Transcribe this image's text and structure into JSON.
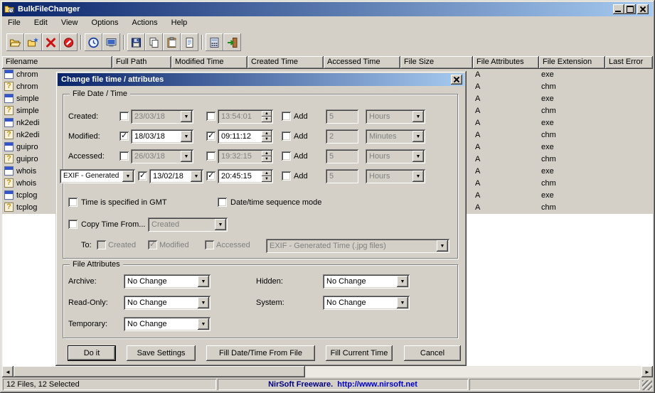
{
  "window": {
    "title": "BulkFileChanger"
  },
  "menu": {
    "items": [
      "File",
      "Edit",
      "View",
      "Options",
      "Actions",
      "Help"
    ]
  },
  "toolbar": {
    "buttons": [
      "open-folder",
      "add-files",
      "remove-files",
      "stop",
      "change-time",
      "view-display",
      "save",
      "copy",
      "paste",
      "properties",
      "advanced-options",
      "exit"
    ]
  },
  "list": {
    "columns": [
      "Filename",
      "Full Path",
      "Modified Time",
      "Created Time",
      "Accessed Time",
      "File Size",
      "File Attributes",
      "File Extension",
      "Last Error"
    ],
    "rows": [
      {
        "filename": "chrom",
        "attributes": "A",
        "extension": "exe",
        "icon": "app-icon"
      },
      {
        "filename": "chrom",
        "attributes": "A",
        "extension": "chm",
        "icon": "help-icon"
      },
      {
        "filename": "simple",
        "attributes": "A",
        "extension": "exe",
        "icon": "app-icon"
      },
      {
        "filename": "simple",
        "attributes": "A",
        "extension": "chm",
        "icon": "help-icon"
      },
      {
        "filename": "nk2edi",
        "attributes": "A",
        "extension": "exe",
        "icon": "app-icon"
      },
      {
        "filename": "nk2edi",
        "attributes": "A",
        "extension": "chm",
        "icon": "help-icon"
      },
      {
        "filename": "guipro",
        "attributes": "A",
        "extension": "exe",
        "icon": "app-icon"
      },
      {
        "filename": "guipro",
        "attributes": "A",
        "extension": "chm",
        "icon": "help-icon"
      },
      {
        "filename": "whois",
        "attributes": "A",
        "extension": "exe",
        "icon": "app-icon"
      },
      {
        "filename": "whois",
        "attributes": "A",
        "extension": "chm",
        "icon": "help-icon"
      },
      {
        "filename": "tcplog",
        "attributes": "A",
        "extension": "exe",
        "icon": "app-icon"
      },
      {
        "filename": "tcplog",
        "attributes": "A",
        "extension": "chm",
        "icon": "help-icon"
      }
    ]
  },
  "dialog": {
    "title": "Change file time / attributes",
    "datetime_group": {
      "label": "File Date / Time",
      "rows": [
        {
          "label": "Created:",
          "date": "23/03/18",
          "date_checked": false,
          "time": "13:54:01",
          "time_checked": false,
          "add_label": "Add",
          "add_checked": false,
          "add_value": "5",
          "add_unit": "Hours",
          "enabled": false
        },
        {
          "label": "Modified:",
          "date": "18/03/18",
          "date_checked": true,
          "time": "09:11:12",
          "time_checked": true,
          "add_label": "Add",
          "add_checked": false,
          "add_value": "2",
          "add_unit": "Minutes",
          "enabled": true
        },
        {
          "label": "Accessed:",
          "date": "26/03/18",
          "date_checked": false,
          "time": "19:32:15",
          "time_checked": false,
          "add_label": "Add",
          "add_checked": false,
          "add_value": "5",
          "add_unit": "Hours",
          "enabled": false
        },
        {
          "label": "EXIF - Generated",
          "date": "13/02/18",
          "date_checked": true,
          "time": "20:45:15",
          "time_checked": true,
          "add_label": "Add",
          "add_checked": false,
          "add_value": "5",
          "add_unit": "Hours",
          "enabled": true,
          "label_is_dropdown": true
        }
      ],
      "gmt_label": "Time is specified in GMT",
      "gmt_checked": false,
      "sequence_label": "Date/time sequence mode",
      "sequence_checked": false,
      "copy_time_label": "Copy Time From...",
      "copy_time_checked": false,
      "copy_time_source": "Created",
      "to_label": "To:",
      "to_created": "Created",
      "to_created_checked": false,
      "to_modified": "Modified",
      "to_modified_checked": true,
      "to_accessed": "Accessed",
      "to_accessed_checked": false,
      "to_destination": "EXIF - Generated Time (.jpg files)"
    },
    "attributes_group": {
      "label": "File Attributes",
      "archive_label": "Archive:",
      "archive_value": "No Change",
      "hidden_label": "Hidden:",
      "hidden_value": "No Change",
      "readonly_label": "Read-Only:",
      "readonly_value": "No Change",
      "system_label": "System:",
      "system_value": "No Change",
      "temporary_label": "Temporary:",
      "temporary_value": "No Change"
    },
    "buttons": {
      "do_it": "Do it",
      "save_settings": "Save Settings",
      "fill_from_file": "Fill Date/Time From File",
      "fill_current": "Fill Current Time",
      "cancel": "Cancel"
    }
  },
  "statusbar": {
    "files_info": "12 Files, 12 Selected",
    "brand": "NirSoft Freeware.",
    "url": "http://www.nirsoft.net"
  },
  "colors": {
    "titlebar_start": "#0a246a",
    "titlebar_end": "#a6caf0",
    "btnface": "#d4d0c8",
    "selection_inactive": "#d4d0c8",
    "brand_navy": "#000080",
    "link": "#0000cc"
  }
}
